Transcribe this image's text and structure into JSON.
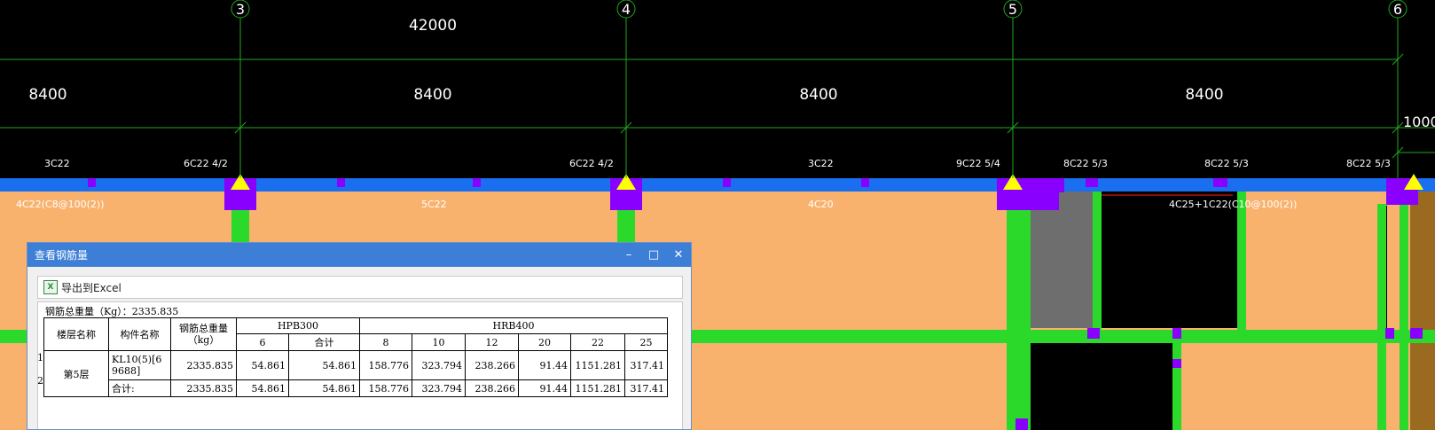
{
  "drawing": {
    "axes": [
      "3",
      "4",
      "5",
      "6"
    ],
    "overall_dimension": "42000",
    "span_dimensions": [
      "8400",
      "8400",
      "8400",
      "8400"
    ],
    "right_dimension": "1000",
    "top_rebar_labels": [
      "3C22",
      "6C22 4/2",
      "6C22 4/2",
      "3C22",
      "9C22 5/4",
      "8C22 5/3",
      "8C22 5/3",
      "8C22 5/3"
    ],
    "bottom_rebar_labels": [
      "4C22(C8@100(2))",
      "5C22",
      "4C20",
      "4C25+1C22(C10@100(2))"
    ],
    "colors": {
      "background": "#000000",
      "beam": "#1a6ff0",
      "slab": "#f9b26e",
      "column_bar": "#2bd92b",
      "support": "#8a00ff",
      "marker": "#ffff00",
      "grey_block": "#707070",
      "axis_line": "#1fa81f"
    }
  },
  "dialog": {
    "title": "查看钢筋量",
    "minimize_icon": "minimize-icon",
    "maximize_icon": "maximize-icon",
    "close_icon": "close-icon",
    "export_label": "导出到Excel",
    "total_label": "钢筋总重量（Kg）：2335.835",
    "table": {
      "headers": {
        "floor": "楼层名称",
        "component": "构件名称",
        "total_weight": "钢筋总重量（kg）",
        "group_hpb": "HPB300",
        "group_hrb": "HRB400",
        "hpb_cols": [
          "6",
          "合计"
        ],
        "hrb_cols": [
          "8",
          "10",
          "12",
          "20",
          "22",
          "25"
        ]
      },
      "row_numbers": [
        "1",
        "2"
      ],
      "floor_name": "第5层",
      "rows": [
        {
          "component": "KL10(5)[69688]",
          "total": "2335.835",
          "hpb6": "54.861",
          "hpb_sum": "54.861",
          "hrb8": "158.776",
          "hrb10": "323.794",
          "hrb12": "238.266",
          "hrb20": "91.44",
          "hrb22": "1151.281",
          "hrb25": "317.41"
        },
        {
          "component": "合计:",
          "total": "2335.835",
          "hpb6": "54.861",
          "hpb_sum": "54.861",
          "hrb8": "158.776",
          "hrb10": "323.794",
          "hrb12": "238.266",
          "hrb20": "91.44",
          "hrb22": "1151.281",
          "hrb25": "317.41"
        }
      ]
    }
  }
}
